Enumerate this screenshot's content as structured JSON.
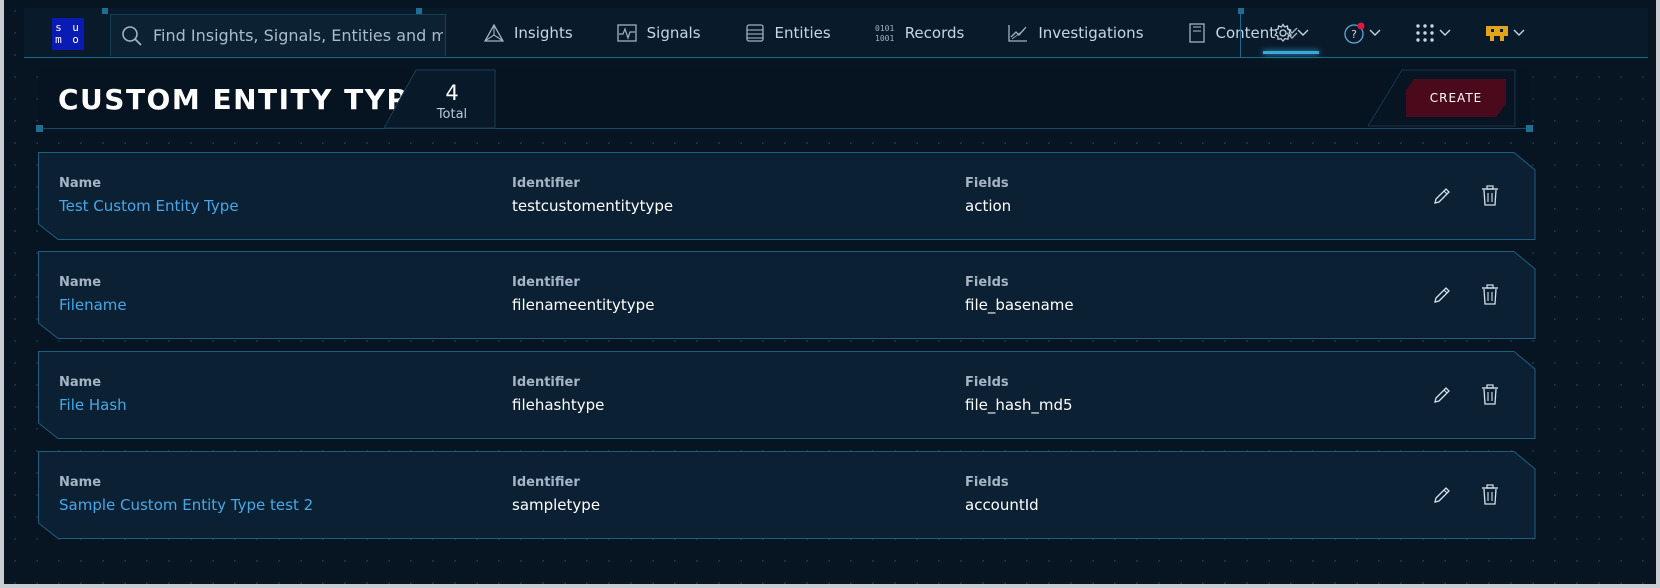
{
  "nav": {
    "logo_lines": [
      "s u",
      "m o"
    ],
    "search_placeholder": "Find Insights, Signals, Entities and more",
    "items": [
      {
        "label": "Insights",
        "icon": "insights-icon"
      },
      {
        "label": "Signals",
        "icon": "signals-icon"
      },
      {
        "label": "Entities",
        "icon": "entities-icon"
      },
      {
        "label": "Records",
        "icon": "records-icon"
      },
      {
        "label": "Investigations",
        "icon": "investigations-icon"
      },
      {
        "label": "Content",
        "icon": "content-icon"
      }
    ],
    "right_icons": [
      "gear-icon",
      "help-icon",
      "apps-grid-icon",
      "avatar-icon"
    ],
    "help_glyph": "?"
  },
  "header": {
    "title": "CUSTOM ENTITY TYPES",
    "total_count": "4",
    "total_label": "Total",
    "create_label": "CREATE"
  },
  "columns": {
    "name": "Name",
    "identifier": "Identifier",
    "fields": "Fields"
  },
  "rows": [
    {
      "name": "Test Custom Entity Type",
      "identifier": "testcustomentitytype",
      "fields": "action"
    },
    {
      "name": "Filename",
      "identifier": "filenameentitytype",
      "fields": "file_basename"
    },
    {
      "name": "File Hash",
      "identifier": "filehashtype",
      "fields": "file_hash_md5"
    },
    {
      "name": "Sample Custom Entity Type test 2",
      "identifier": "sampletype",
      "fields": "accountId"
    }
  ],
  "colors": {
    "accent": "#47a7e6",
    "create_glow": "#d3174a",
    "notification_dot": "#e0173f",
    "avatar": "#e0a51b",
    "logo_bg": "#0a1bb4"
  }
}
